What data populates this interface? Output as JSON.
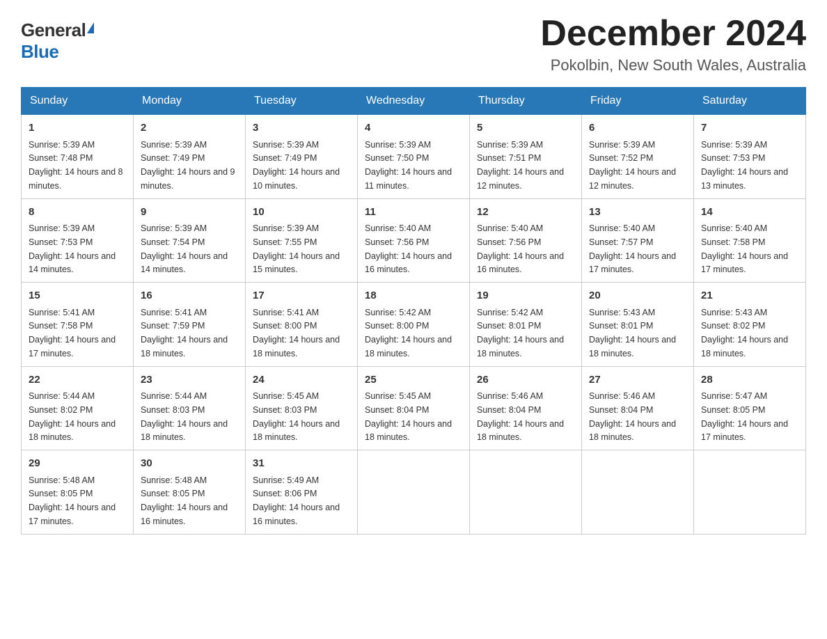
{
  "logo": {
    "general": "General",
    "blue": "Blue"
  },
  "title": "December 2024",
  "location": "Pokolbin, New South Wales, Australia",
  "weekdays": [
    "Sunday",
    "Monday",
    "Tuesday",
    "Wednesday",
    "Thursday",
    "Friday",
    "Saturday"
  ],
  "weeks": [
    [
      {
        "day": 1,
        "sunrise": "5:39 AM",
        "sunset": "7:48 PM",
        "daylight": "14 hours and 8 minutes."
      },
      {
        "day": 2,
        "sunrise": "5:39 AM",
        "sunset": "7:49 PM",
        "daylight": "14 hours and 9 minutes."
      },
      {
        "day": 3,
        "sunrise": "5:39 AM",
        "sunset": "7:49 PM",
        "daylight": "14 hours and 10 minutes."
      },
      {
        "day": 4,
        "sunrise": "5:39 AM",
        "sunset": "7:50 PM",
        "daylight": "14 hours and 11 minutes."
      },
      {
        "day": 5,
        "sunrise": "5:39 AM",
        "sunset": "7:51 PM",
        "daylight": "14 hours and 12 minutes."
      },
      {
        "day": 6,
        "sunrise": "5:39 AM",
        "sunset": "7:52 PM",
        "daylight": "14 hours and 12 minutes."
      },
      {
        "day": 7,
        "sunrise": "5:39 AM",
        "sunset": "7:53 PM",
        "daylight": "14 hours and 13 minutes."
      }
    ],
    [
      {
        "day": 8,
        "sunrise": "5:39 AM",
        "sunset": "7:53 PM",
        "daylight": "14 hours and 14 minutes."
      },
      {
        "day": 9,
        "sunrise": "5:39 AM",
        "sunset": "7:54 PM",
        "daylight": "14 hours and 14 minutes."
      },
      {
        "day": 10,
        "sunrise": "5:39 AM",
        "sunset": "7:55 PM",
        "daylight": "14 hours and 15 minutes."
      },
      {
        "day": 11,
        "sunrise": "5:40 AM",
        "sunset": "7:56 PM",
        "daylight": "14 hours and 16 minutes."
      },
      {
        "day": 12,
        "sunrise": "5:40 AM",
        "sunset": "7:56 PM",
        "daylight": "14 hours and 16 minutes."
      },
      {
        "day": 13,
        "sunrise": "5:40 AM",
        "sunset": "7:57 PM",
        "daylight": "14 hours and 17 minutes."
      },
      {
        "day": 14,
        "sunrise": "5:40 AM",
        "sunset": "7:58 PM",
        "daylight": "14 hours and 17 minutes."
      }
    ],
    [
      {
        "day": 15,
        "sunrise": "5:41 AM",
        "sunset": "7:58 PM",
        "daylight": "14 hours and 17 minutes."
      },
      {
        "day": 16,
        "sunrise": "5:41 AM",
        "sunset": "7:59 PM",
        "daylight": "14 hours and 18 minutes."
      },
      {
        "day": 17,
        "sunrise": "5:41 AM",
        "sunset": "8:00 PM",
        "daylight": "14 hours and 18 minutes."
      },
      {
        "day": 18,
        "sunrise": "5:42 AM",
        "sunset": "8:00 PM",
        "daylight": "14 hours and 18 minutes."
      },
      {
        "day": 19,
        "sunrise": "5:42 AM",
        "sunset": "8:01 PM",
        "daylight": "14 hours and 18 minutes."
      },
      {
        "day": 20,
        "sunrise": "5:43 AM",
        "sunset": "8:01 PM",
        "daylight": "14 hours and 18 minutes."
      },
      {
        "day": 21,
        "sunrise": "5:43 AM",
        "sunset": "8:02 PM",
        "daylight": "14 hours and 18 minutes."
      }
    ],
    [
      {
        "day": 22,
        "sunrise": "5:44 AM",
        "sunset": "8:02 PM",
        "daylight": "14 hours and 18 minutes."
      },
      {
        "day": 23,
        "sunrise": "5:44 AM",
        "sunset": "8:03 PM",
        "daylight": "14 hours and 18 minutes."
      },
      {
        "day": 24,
        "sunrise": "5:45 AM",
        "sunset": "8:03 PM",
        "daylight": "14 hours and 18 minutes."
      },
      {
        "day": 25,
        "sunrise": "5:45 AM",
        "sunset": "8:04 PM",
        "daylight": "14 hours and 18 minutes."
      },
      {
        "day": 26,
        "sunrise": "5:46 AM",
        "sunset": "8:04 PM",
        "daylight": "14 hours and 18 minutes."
      },
      {
        "day": 27,
        "sunrise": "5:46 AM",
        "sunset": "8:04 PM",
        "daylight": "14 hours and 18 minutes."
      },
      {
        "day": 28,
        "sunrise": "5:47 AM",
        "sunset": "8:05 PM",
        "daylight": "14 hours and 17 minutes."
      }
    ],
    [
      {
        "day": 29,
        "sunrise": "5:48 AM",
        "sunset": "8:05 PM",
        "daylight": "14 hours and 17 minutes."
      },
      {
        "day": 30,
        "sunrise": "5:48 AM",
        "sunset": "8:05 PM",
        "daylight": "14 hours and 16 minutes."
      },
      {
        "day": 31,
        "sunrise": "5:49 AM",
        "sunset": "8:06 PM",
        "daylight": "14 hours and 16 minutes."
      },
      null,
      null,
      null,
      null
    ]
  ]
}
